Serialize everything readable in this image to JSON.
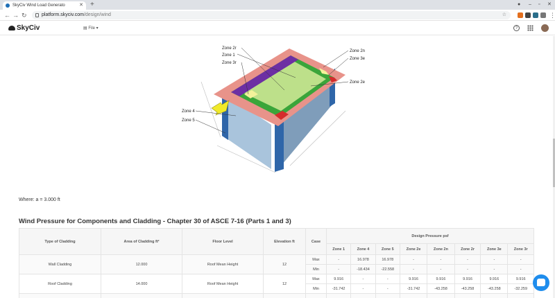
{
  "browser": {
    "tab_title": "SkyCiv Wind Load Generato",
    "url_domain": "platform.skyciv.com",
    "url_path": "/design/wind"
  },
  "app": {
    "logo": "SkyCiv",
    "file_menu": "File"
  },
  "diagram": {
    "zone_labels": [
      "Zone 2r",
      "Zone 1",
      "Zone 3r",
      "Zone 2n",
      "Zone 3e",
      "Zone 2e",
      "Zone 4",
      "Zone 5"
    ],
    "colors": {
      "wall_front": "#a9c4dc",
      "wall_side": "#7f9dba",
      "edge": "#2f66a9",
      "zone_outer": "#e8938a",
      "zone_mid": "#3aa53a",
      "zone_inner": "#bde08a",
      "zone_purple": "#6d2fa3",
      "zone_red": "#d42c2c",
      "zone_yellow": "#f3f29a",
      "arrow": "#f1ea2a"
    }
  },
  "where_text": "Where: a = 3.000 ft",
  "section_title": "Wind Pressure for Components and Cladding - Chapter 30 of ASCE 7-16 (Parts 1 and 3)",
  "table": {
    "headers": {
      "type": "Type of Cladding",
      "area": "Area of Cladding ft²",
      "floor": "Floor Level",
      "elevation": "Elevation ft",
      "case": "Case",
      "design": "Design Pressure psf"
    },
    "zones": [
      "Zone 1",
      "Zone 4",
      "Zone 5",
      "Zone 2e",
      "Zone 2n",
      "Zone 2r",
      "Zone 3e",
      "Zone 3r"
    ],
    "rows": [
      {
        "type": "Wall Cladding",
        "area": "12.000",
        "floor": "Roof Mean Height",
        "elevation": "12",
        "max": [
          "-",
          "16.978",
          "16.978",
          "-",
          "-",
          "-",
          "-",
          "-"
        ],
        "min": [
          "-",
          "-18.434",
          "-22.558",
          "-",
          "-",
          "-",
          "-",
          "-"
        ]
      },
      {
        "type": "Roof Cladding",
        "area": "14.000",
        "floor": "Roof Mean Height",
        "elevation": "12",
        "max": [
          "9.916",
          "-",
          "-",
          "9.916",
          "9.916",
          "9.916",
          "9.916",
          "9.916"
        ],
        "min": [
          "-31.742",
          "-",
          "-",
          "-31.742",
          "-43.258",
          "-43.258",
          "-43.258",
          "-32.259"
        ]
      }
    ],
    "case_max": "Max",
    "case_min": "Min"
  }
}
